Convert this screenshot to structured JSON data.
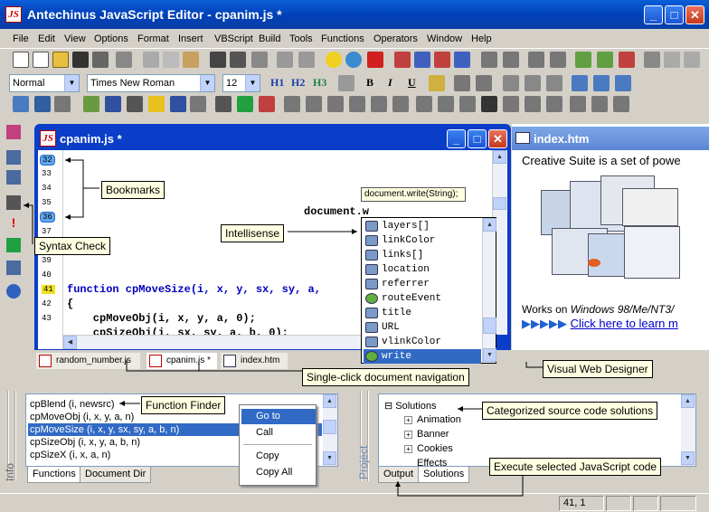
{
  "window": {
    "title": "Antechinus JavaScript Editor - cpanim.js *"
  },
  "menu": [
    "File",
    "Edit",
    "View",
    "Options",
    "Format",
    "Insert",
    "VBScript",
    "Build",
    "Tools",
    "Functions",
    "Operators",
    "Window",
    "Help"
  ],
  "format_bar": {
    "style": "Normal",
    "font": "Times New Roman",
    "size": "12",
    "h1": "H1",
    "h2": "H2",
    "h3": "H3",
    "bold": "B",
    "italic": "I",
    "underline": "U"
  },
  "editor": {
    "title": "cpanim.js *",
    "line_numbers": [
      "32",
      "33",
      "34",
      "35",
      "36",
      "37",
      "38",
      "39",
      "40",
      "41",
      "42",
      "43"
    ],
    "code_lines": [
      {
        "text": "document.w",
        "keyword": false
      },
      {
        "text": "function cpMoveSize(i, x, y, sx, sy, a,",
        "keyword": true
      },
      {
        "text": "{",
        "keyword": false
      },
      {
        "text": "    cpMoveObj(i, x, y, a, 0);",
        "keyword": false
      },
      {
        "text": "    cpSizeObj(i, sx, sy, a, b, 0);",
        "keyword": false
      }
    ],
    "tooltip": "document.write(String);"
  },
  "autocomplete": [
    "layers[]",
    "linkColor",
    "links[]",
    "location",
    "referrer",
    "routeEvent",
    "title",
    "URL",
    "vlinkColor",
    "write"
  ],
  "autocomplete_selected": "write",
  "callouts": {
    "bookmarks": "Bookmarks",
    "intellisense": "Intellisense",
    "syntax_check": "Syntax Check",
    "doc_nav": "Single-click document navigation",
    "visual_designer": "Visual Web Designer",
    "function_finder": "Function Finder",
    "categorized": "Categorized source code solutions",
    "execute": "Execute selected JavaScript code"
  },
  "designer": {
    "title": "index.htm",
    "text1": "Creative Suite is a set of powe",
    "text2_prefix": "Works on ",
    "text2_os": "Windows 98/Me/NT3/",
    "arrows": "▶▶▶▶▶",
    "link": "Click here to learn m"
  },
  "doc_tabs": [
    "random_number.js",
    "cpanim.js *",
    "index.htm"
  ],
  "function_finder": {
    "items": [
      "cpBlend (i, newsrc)",
      "cpMoveObj (i, x, y, a, n)",
      "cpMoveSize (i, x, y, sx, sy, a, b, n)",
      "cpSizeObj (i, x, y, a, b, n)",
      "cpSizeX (i, x, a, n)"
    ],
    "selected_index": 2,
    "tabs": [
      "Functions",
      "Document Dir"
    ],
    "side_label": "Info"
  },
  "context_menu": {
    "items": [
      "Go to",
      "Call",
      "Copy",
      "Copy All"
    ],
    "selected": "Go to"
  },
  "project": {
    "root": "Solutions",
    "children": [
      "Animation",
      "Banner",
      "Cookies",
      "Effects"
    ],
    "tabs": [
      "Output",
      "Solutions"
    ],
    "side_label": "Project"
  },
  "status": {
    "position": "41, 1"
  },
  "colors": {
    "title_blue": "#0a5fd8",
    "selection": "#316ac5",
    "callout_bg": "#ffffe1",
    "editor_frame": "#0a3ec8"
  }
}
